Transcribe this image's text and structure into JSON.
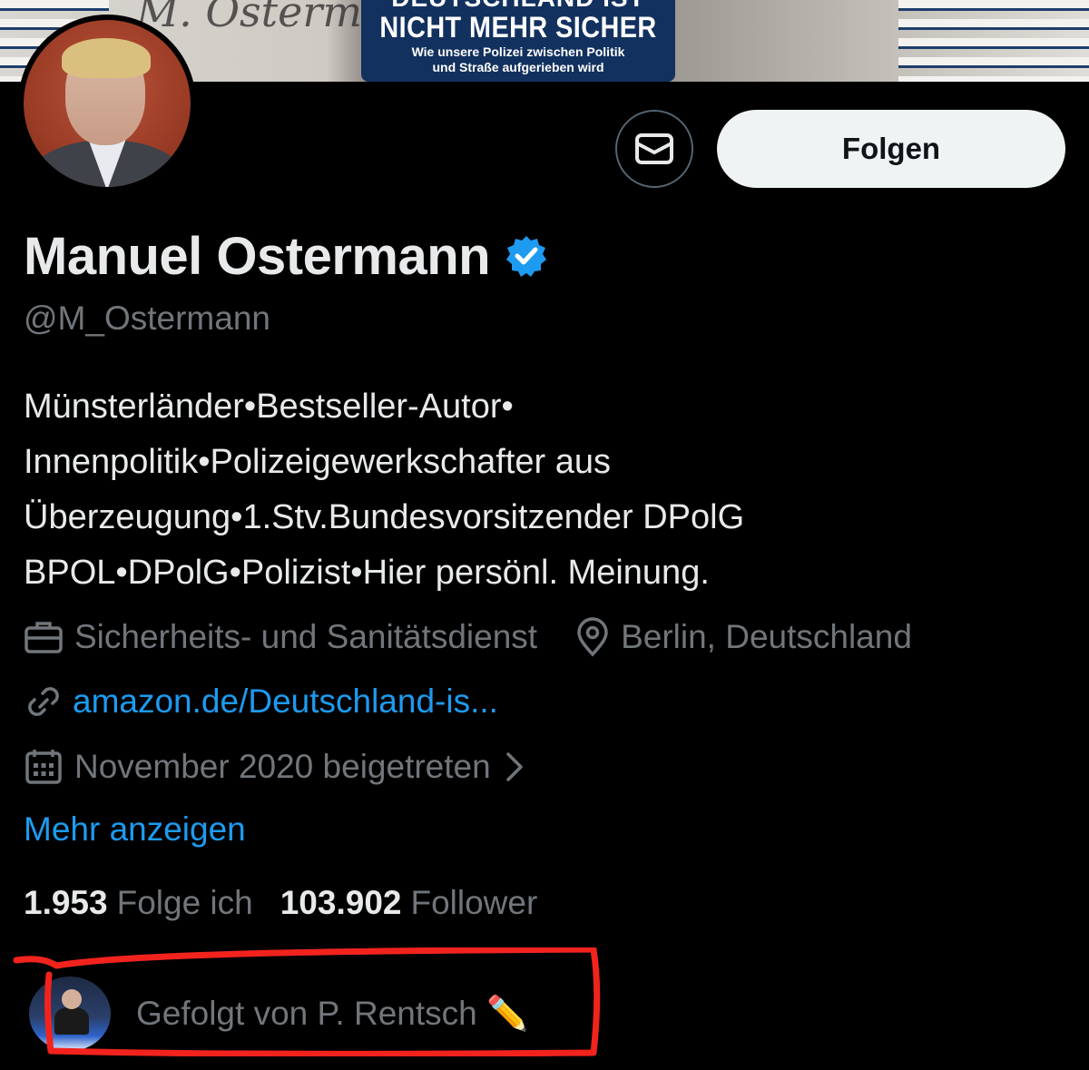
{
  "banner": {
    "book_top_text": "DEUTSCHLAND IST",
    "book_title": "NICHT MEHR SICHER",
    "book_subtitle_line1": "Wie unsere Polizei zwischen Politik",
    "book_subtitle_line2": "und Straße aufgerieben wird",
    "signature_text": "M. Osterm"
  },
  "actions": {
    "follow_label": "Folgen",
    "message_icon": "envelope-icon"
  },
  "profile": {
    "name": "Manuel Ostermann",
    "handle": "@M_Ostermann",
    "verified_color": "#1d9bf0",
    "bio": "Münsterländer•Bestseller-Autor•\nInnenpolitik•Polizeigewerkschafter aus\nÜberzeugung•1.Stv.Bundesvorsitzender DPolG\nBPOL•DPolG•Polizist•Hier persönl. Meinung.",
    "category": "Sicherheits- und Sanitätsdienst",
    "location": "Berlin, Deutschland",
    "link": "amazon.de/Deutschland-is...",
    "joined": "November 2020 beigetreten",
    "show_more": "Mehr anzeigen"
  },
  "stats": {
    "following_count": "1.953",
    "following_label": "Folge ich",
    "followers_count": "103.902",
    "followers_label": "Follower"
  },
  "followed_by": {
    "text": "Gefolgt von P. Rentsch ✏️"
  },
  "colors": {
    "accent": "#1d9bf0",
    "muted": "#71767b",
    "annotation": "#f2231d"
  }
}
